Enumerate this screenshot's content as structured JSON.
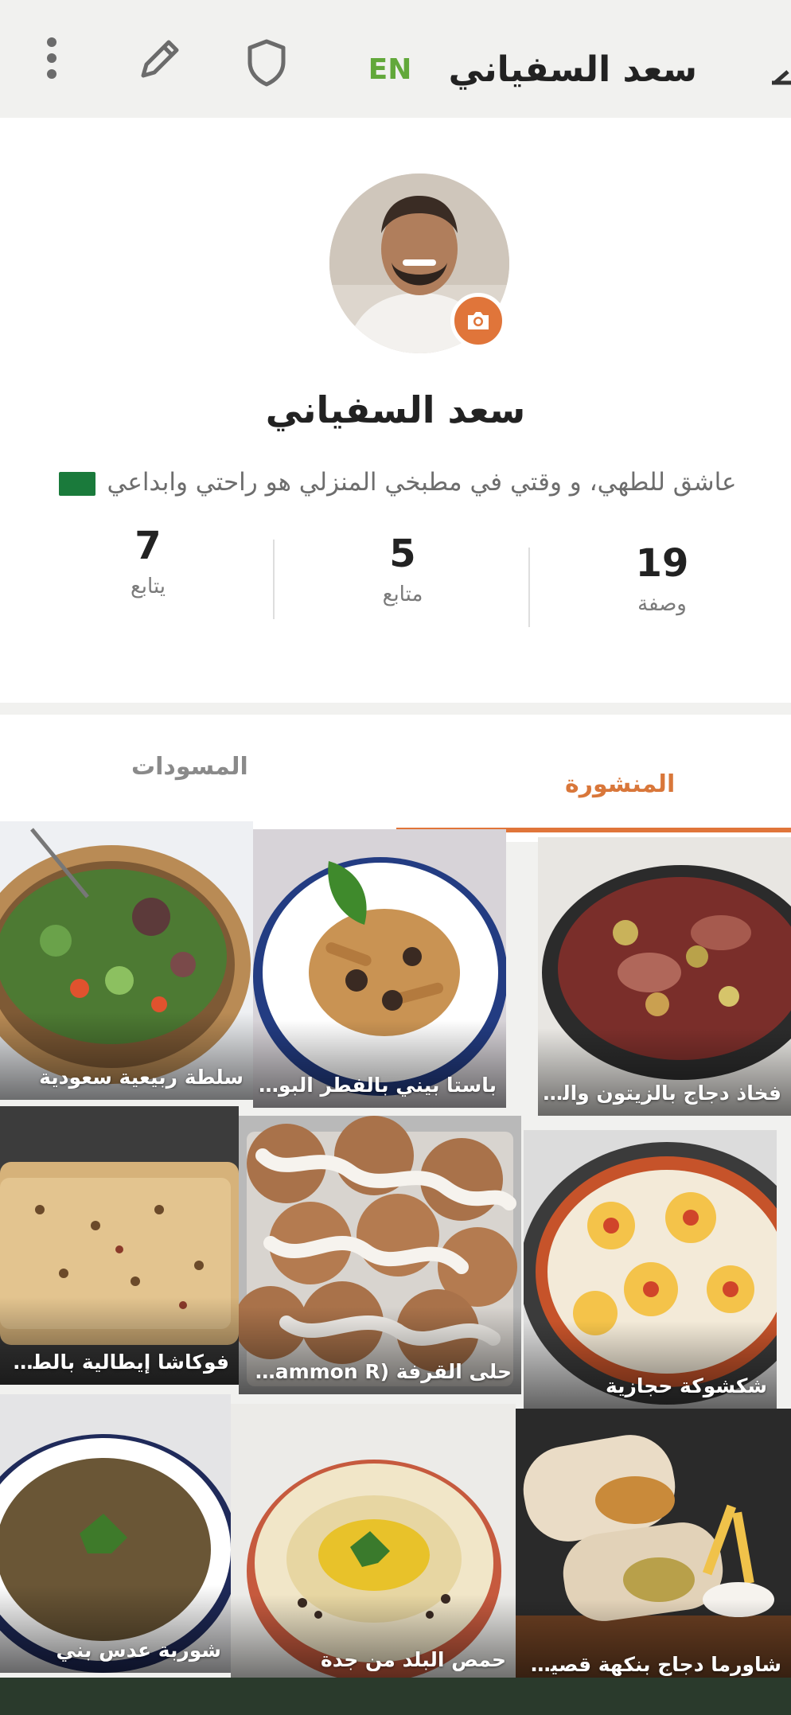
{
  "appbar": {
    "title": "سعد السفياني",
    "lang_label": "EN",
    "icons": [
      "more-vertical-icon",
      "pencil-icon",
      "shield-icon",
      "back-arrow-icon"
    ]
  },
  "profile": {
    "name": "سعد السفياني",
    "bio": "عاشق للطهي، و وقتي في مطبخي المنزلي هو راحتي وابداعي",
    "flag": "saudi-flag-icon",
    "stats": {
      "recipes": {
        "value": "19",
        "label": "وصفة"
      },
      "followers": {
        "value": "5",
        "label": "متابع"
      },
      "following": {
        "value": "7",
        "label": "يتابع"
      }
    }
  },
  "tabs": {
    "published": "المنشورة",
    "drafts": "المسودات"
  },
  "recipes": [
    {
      "title": "فخاذ دجاج بالزيتون والبصل ..."
    },
    {
      "title": "باستا بيني بالفطر البورتشيني"
    },
    {
      "title": "سلطة ربيعية سعودية"
    },
    {
      "title": "شكشوكة حجازية"
    },
    {
      "title": "حلى القرفة (Cinammon R..."
    },
    {
      "title": "فوكاشا إيطالية بالطماطم و"
    },
    {
      "title": "شاورما دجاج بنكهة قصيمية ..."
    },
    {
      "title": "حمص البلد من جدة"
    },
    {
      "title": "شوربة عدس بني"
    }
  ],
  "colors": {
    "accent": "#e0753a",
    "lang": "#62a83a",
    "background": "#f1f1ef"
  }
}
